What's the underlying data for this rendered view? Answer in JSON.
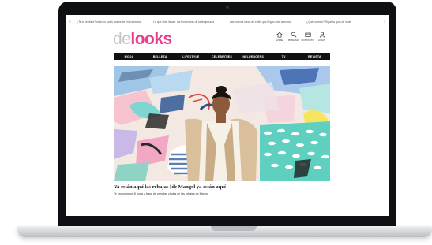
{
  "promo_bar": {
    "messages": [
      "¿Te lo perdiste? mira los looks virales de esta semana",
      "Lo que ellas llevan: las tendencias de la temporada",
      "Las nuevas ideas de estilo que llegan esta semana",
      "¿Qué ponerte? Sigue la guía de looks"
    ]
  },
  "logo": {
    "prefix": "de",
    "brand": "looks"
  },
  "header_icons": [
    {
      "icon": "home-icon",
      "label": "HOME"
    },
    {
      "icon": "search-icon",
      "label": "BUSCAR"
    },
    {
      "icon": "mail-icon",
      "label": "CONTACTO"
    },
    {
      "icon": "user-icon",
      "label": "LOGIN"
    }
  ],
  "nav": {
    "items": [
      "MODA",
      "BELLEZA",
      "LIFESTYLE",
      "CELEBRITIES",
      "INFLUENCERS",
      "TV",
      "REVISTA"
    ]
  },
  "article": {
    "headline": "Ya están aquí las rebajas [de Mangol ya están aquí",
    "subline": "Te proponemos 8 looks a base de prendas chulas en las rebajas de Mango"
  },
  "colors": {
    "brand_pink": "#e53c8d",
    "nav_bg": "#111111",
    "bezel": "#0f1013"
  }
}
